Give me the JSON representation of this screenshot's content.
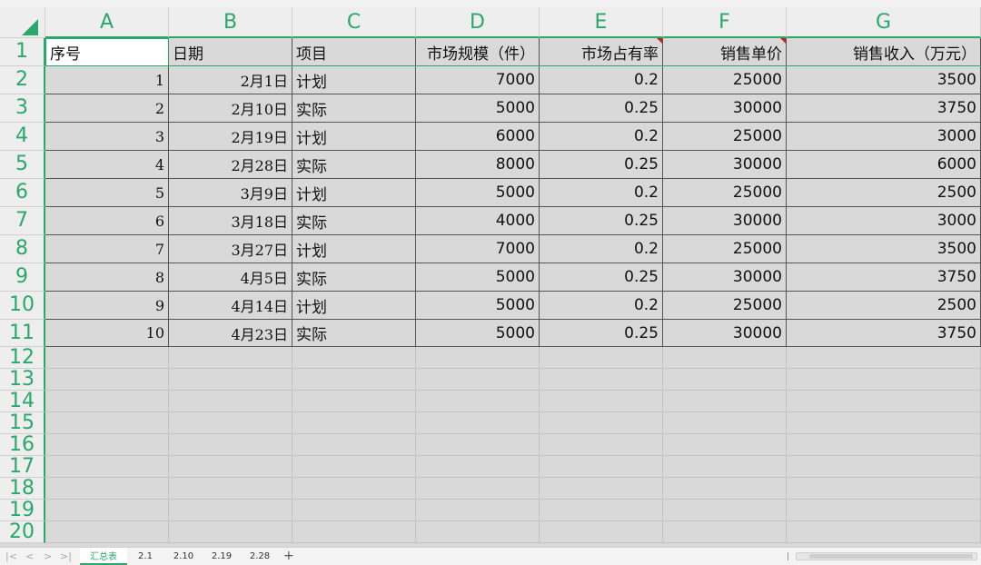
{
  "sheet": {
    "columns": [
      "A",
      "B",
      "C",
      "D",
      "E",
      "F",
      "G"
    ],
    "rows": [
      "1",
      "2",
      "3",
      "4",
      "5",
      "6",
      "7",
      "8",
      "9",
      "10",
      "11",
      "12",
      "13",
      "14",
      "15",
      "16",
      "17",
      "18",
      "19",
      "20"
    ],
    "header": [
      "序号",
      "日期",
      "项目",
      "市场规模（件）",
      "市场占有率",
      "销售单价",
      "销售收入（万元）"
    ],
    "data": [
      [
        "1",
        "2月1日",
        "计划",
        "7000",
        "0.2",
        "25000",
        "3500"
      ],
      [
        "2",
        "2月10日",
        "实际",
        "5000",
        "0.25",
        "30000",
        "3750"
      ],
      [
        "3",
        "2月19日",
        "计划",
        "6000",
        "0.2",
        "25000",
        "3000"
      ],
      [
        "4",
        "2月28日",
        "实际",
        "8000",
        "0.25",
        "30000",
        "6000"
      ],
      [
        "5",
        "3月9日",
        "计划",
        "5000",
        "0.2",
        "25000",
        "2500"
      ],
      [
        "6",
        "3月18日",
        "实际",
        "4000",
        "0.25",
        "30000",
        "3000"
      ],
      [
        "7",
        "3月27日",
        "计划",
        "7000",
        "0.2",
        "25000",
        "3500"
      ],
      [
        "8",
        "4月5日",
        "实际",
        "5000",
        "0.25",
        "30000",
        "3750"
      ],
      [
        "9",
        "4月14日",
        "计划",
        "5000",
        "0.2",
        "25000",
        "2500"
      ],
      [
        "10",
        "4月23日",
        "实际",
        "5000",
        "0.25",
        "30000",
        "3750"
      ]
    ]
  },
  "tabs": [
    "汇总表",
    "2.1",
    "2.10",
    "2.19",
    "2.28"
  ],
  "tabbar": {
    "nav": [
      "|<",
      "<",
      ">",
      ">|"
    ],
    "add": "+"
  },
  "colors": {
    "accent": "#2aa86b",
    "comment_marker": "#cc2222"
  }
}
